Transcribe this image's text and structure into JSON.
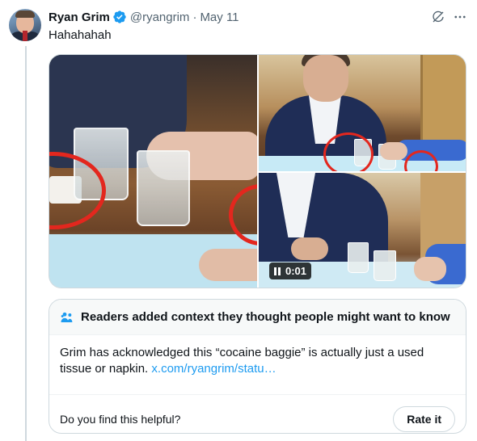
{
  "post": {
    "author_name": "Ryan Grim",
    "handle": "@ryangrim",
    "separator": "·",
    "date": "May 11",
    "text": "Hahahahah",
    "verified": true
  },
  "media": {
    "count": 3,
    "video_time": "0:01"
  },
  "community_note": {
    "title": "Readers added context they thought people might want to know",
    "body": "Grim has acknowledged this “cocaine baggie” is actually just a used tissue or napkin.",
    "link_text": "x.com/ryangrim/statu…",
    "question": "Do you find this helpful?",
    "rate_button": "Rate it"
  },
  "colors": {
    "accent": "#1d9bf0",
    "text": "#0f1419",
    "secondary_text": "#536471",
    "border": "#cfd9de",
    "highlight_circle": "#e3271e"
  },
  "icons": {
    "verified": "verified-badge-icon",
    "grok": "grok-icon",
    "more": "more-dots-icon",
    "note": "people-icon",
    "pause": "pause-icon"
  }
}
